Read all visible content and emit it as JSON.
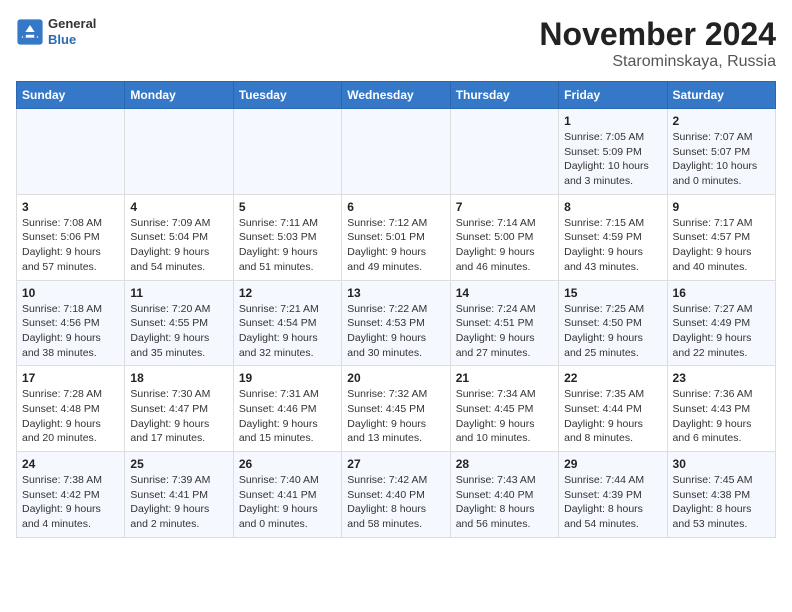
{
  "header": {
    "logo": {
      "general": "General",
      "blue": "Blue"
    },
    "title": "November 2024",
    "subtitle": "Starominskaya, Russia"
  },
  "weekdays": [
    "Sunday",
    "Monday",
    "Tuesday",
    "Wednesday",
    "Thursday",
    "Friday",
    "Saturday"
  ],
  "weeks": [
    [
      {
        "day": "",
        "info": ""
      },
      {
        "day": "",
        "info": ""
      },
      {
        "day": "",
        "info": ""
      },
      {
        "day": "",
        "info": ""
      },
      {
        "day": "",
        "info": ""
      },
      {
        "day": "1",
        "info": "Sunrise: 7:05 AM\nSunset: 5:09 PM\nDaylight: 10 hours and 3 minutes."
      },
      {
        "day": "2",
        "info": "Sunrise: 7:07 AM\nSunset: 5:07 PM\nDaylight: 10 hours and 0 minutes."
      }
    ],
    [
      {
        "day": "3",
        "info": "Sunrise: 7:08 AM\nSunset: 5:06 PM\nDaylight: 9 hours and 57 minutes."
      },
      {
        "day": "4",
        "info": "Sunrise: 7:09 AM\nSunset: 5:04 PM\nDaylight: 9 hours and 54 minutes."
      },
      {
        "day": "5",
        "info": "Sunrise: 7:11 AM\nSunset: 5:03 PM\nDaylight: 9 hours and 51 minutes."
      },
      {
        "day": "6",
        "info": "Sunrise: 7:12 AM\nSunset: 5:01 PM\nDaylight: 9 hours and 49 minutes."
      },
      {
        "day": "7",
        "info": "Sunrise: 7:14 AM\nSunset: 5:00 PM\nDaylight: 9 hours and 46 minutes."
      },
      {
        "day": "8",
        "info": "Sunrise: 7:15 AM\nSunset: 4:59 PM\nDaylight: 9 hours and 43 minutes."
      },
      {
        "day": "9",
        "info": "Sunrise: 7:17 AM\nSunset: 4:57 PM\nDaylight: 9 hours and 40 minutes."
      }
    ],
    [
      {
        "day": "10",
        "info": "Sunrise: 7:18 AM\nSunset: 4:56 PM\nDaylight: 9 hours and 38 minutes."
      },
      {
        "day": "11",
        "info": "Sunrise: 7:20 AM\nSunset: 4:55 PM\nDaylight: 9 hours and 35 minutes."
      },
      {
        "day": "12",
        "info": "Sunrise: 7:21 AM\nSunset: 4:54 PM\nDaylight: 9 hours and 32 minutes."
      },
      {
        "day": "13",
        "info": "Sunrise: 7:22 AM\nSunset: 4:53 PM\nDaylight: 9 hours and 30 minutes."
      },
      {
        "day": "14",
        "info": "Sunrise: 7:24 AM\nSunset: 4:51 PM\nDaylight: 9 hours and 27 minutes."
      },
      {
        "day": "15",
        "info": "Sunrise: 7:25 AM\nSunset: 4:50 PM\nDaylight: 9 hours and 25 minutes."
      },
      {
        "day": "16",
        "info": "Sunrise: 7:27 AM\nSunset: 4:49 PM\nDaylight: 9 hours and 22 minutes."
      }
    ],
    [
      {
        "day": "17",
        "info": "Sunrise: 7:28 AM\nSunset: 4:48 PM\nDaylight: 9 hours and 20 minutes."
      },
      {
        "day": "18",
        "info": "Sunrise: 7:30 AM\nSunset: 4:47 PM\nDaylight: 9 hours and 17 minutes."
      },
      {
        "day": "19",
        "info": "Sunrise: 7:31 AM\nSunset: 4:46 PM\nDaylight: 9 hours and 15 minutes."
      },
      {
        "day": "20",
        "info": "Sunrise: 7:32 AM\nSunset: 4:45 PM\nDaylight: 9 hours and 13 minutes."
      },
      {
        "day": "21",
        "info": "Sunrise: 7:34 AM\nSunset: 4:45 PM\nDaylight: 9 hours and 10 minutes."
      },
      {
        "day": "22",
        "info": "Sunrise: 7:35 AM\nSunset: 4:44 PM\nDaylight: 9 hours and 8 minutes."
      },
      {
        "day": "23",
        "info": "Sunrise: 7:36 AM\nSunset: 4:43 PM\nDaylight: 9 hours and 6 minutes."
      }
    ],
    [
      {
        "day": "24",
        "info": "Sunrise: 7:38 AM\nSunset: 4:42 PM\nDaylight: 9 hours and 4 minutes."
      },
      {
        "day": "25",
        "info": "Sunrise: 7:39 AM\nSunset: 4:41 PM\nDaylight: 9 hours and 2 minutes."
      },
      {
        "day": "26",
        "info": "Sunrise: 7:40 AM\nSunset: 4:41 PM\nDaylight: 9 hours and 0 minutes."
      },
      {
        "day": "27",
        "info": "Sunrise: 7:42 AM\nSunset: 4:40 PM\nDaylight: 8 hours and 58 minutes."
      },
      {
        "day": "28",
        "info": "Sunrise: 7:43 AM\nSunset: 4:40 PM\nDaylight: 8 hours and 56 minutes."
      },
      {
        "day": "29",
        "info": "Sunrise: 7:44 AM\nSunset: 4:39 PM\nDaylight: 8 hours and 54 minutes."
      },
      {
        "day": "30",
        "info": "Sunrise: 7:45 AM\nSunset: 4:38 PM\nDaylight: 8 hours and 53 minutes."
      }
    ]
  ]
}
